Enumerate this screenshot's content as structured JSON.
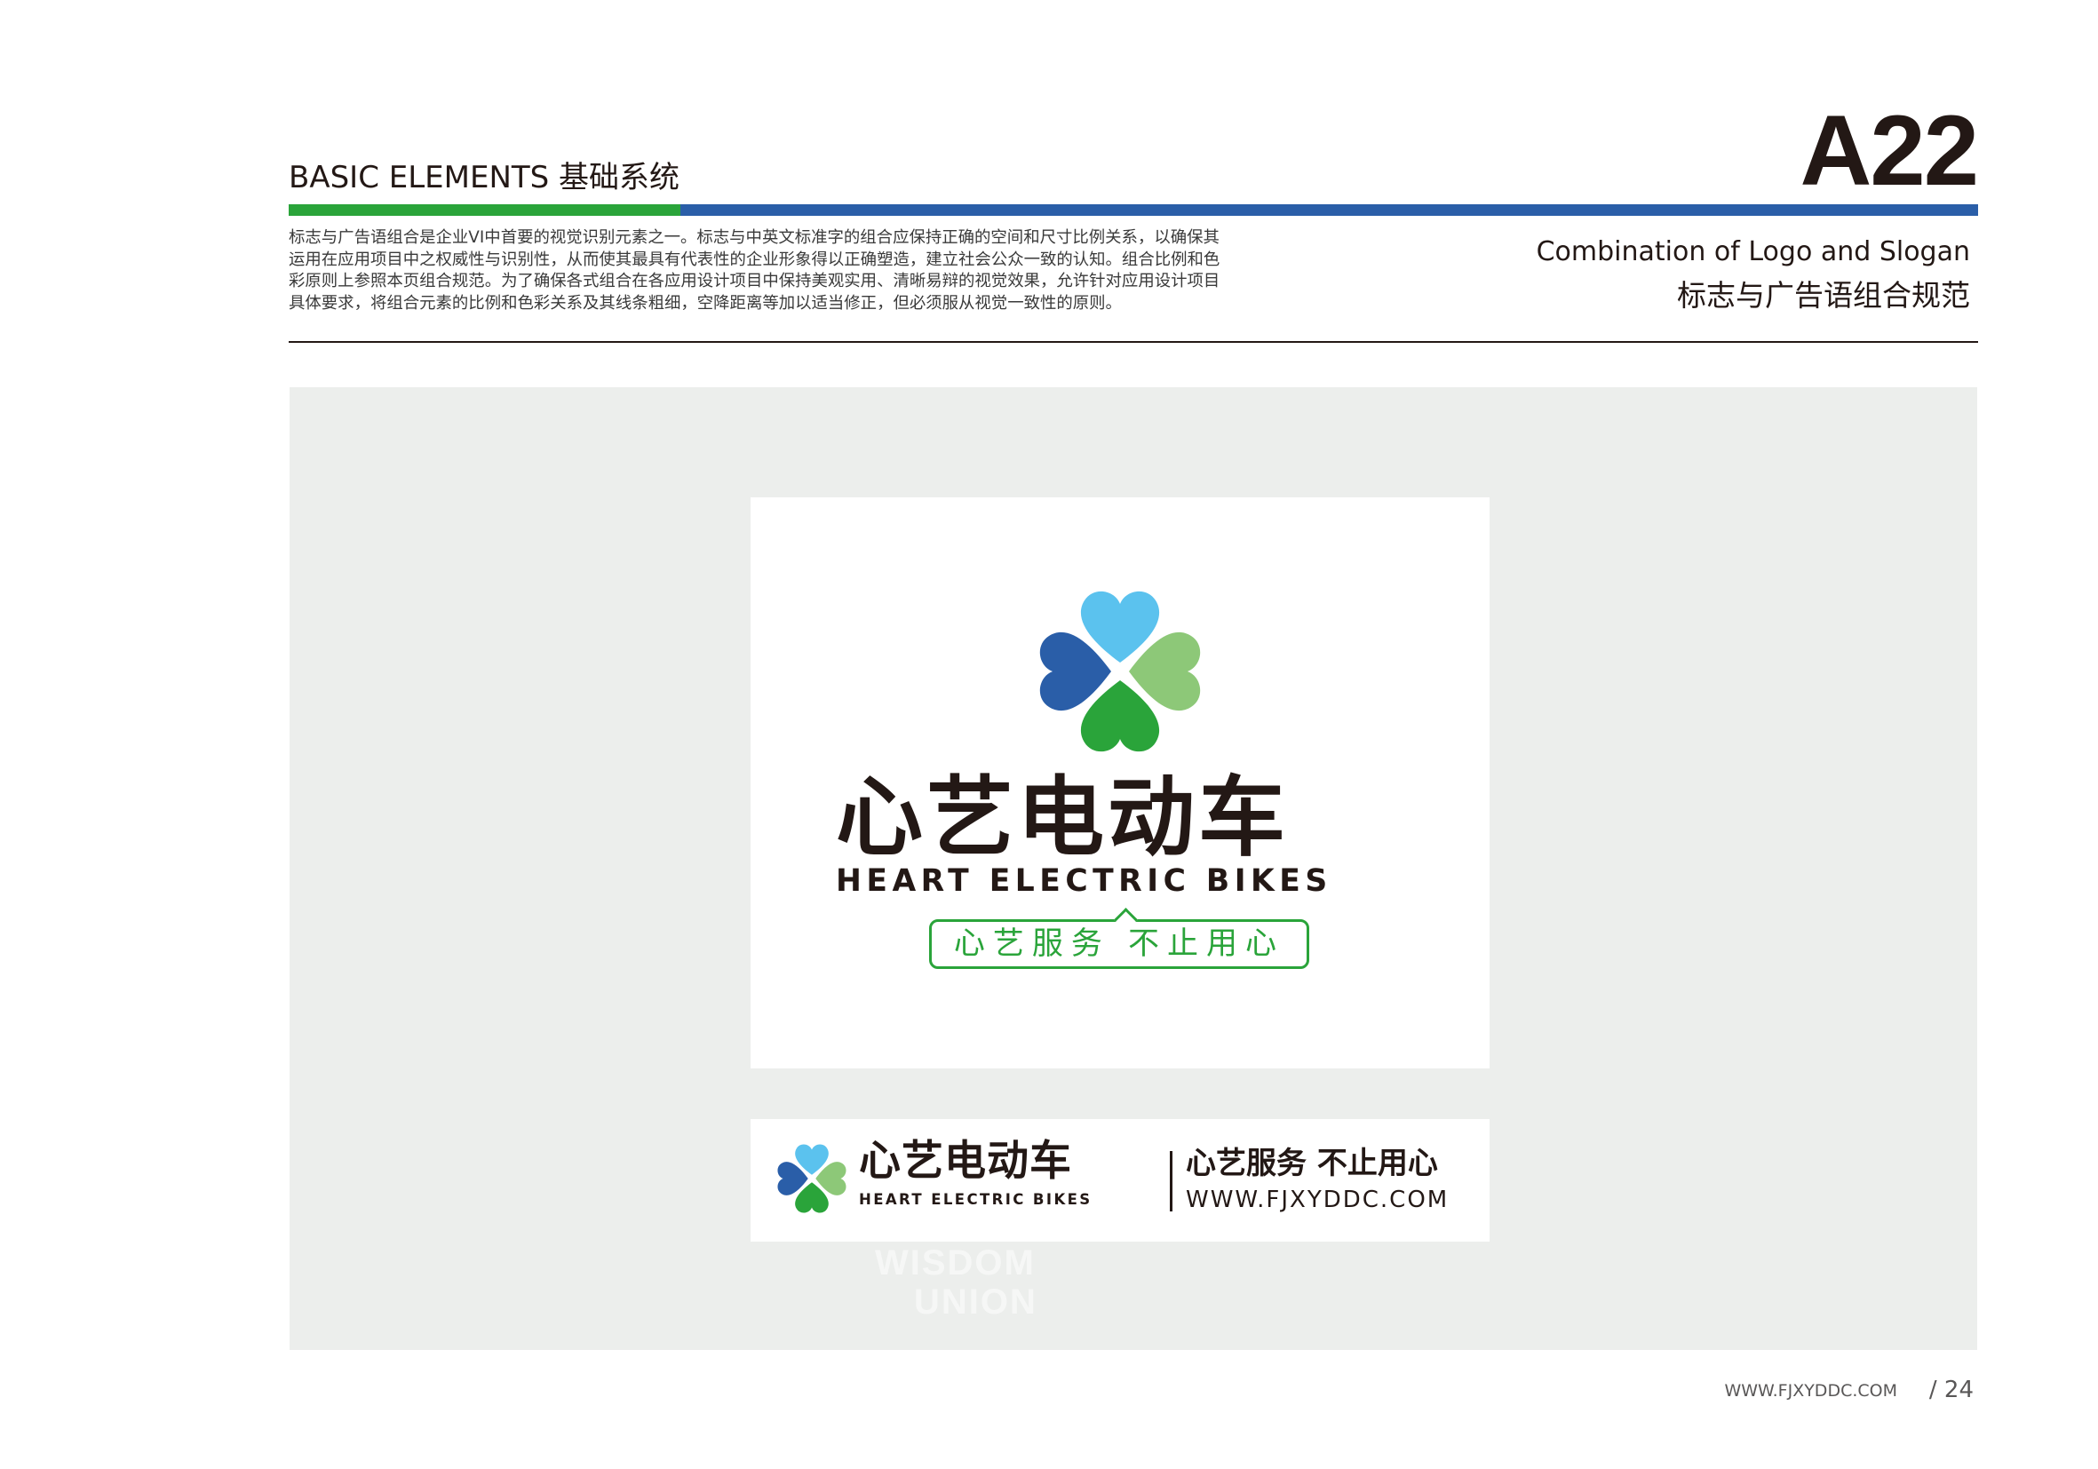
{
  "header": {
    "section_title": "BASIC ELEMENTS 基础系统",
    "page_code": "A22",
    "heading_en": "Combination of Logo and Slogan",
    "heading_zh": "标志与广告语组合规范",
    "intro_lines": [
      "标志与广告语组合是企业VI中首要的视觉识别元素之一。标志与中英文标准字的组合应保持正确的空间和尺寸比例关系，以确保其",
      "运用在应用项目中之权威性与识别性，从而使其最具有代表性的企业形象得以正确塑造，建立社会公众一致的认知。组合比例和色",
      "彩原则上参照本页组合规范。为了确保各式组合在各应用设计项目中保持美观实用、清晰易辩的视觉效果，允许针对应用设计项目",
      "具体要求，将组合元素的比例和色彩关系及其线条粗细，空降距离等加以适当修正，但必须服从视觉一致性的原则。"
    ]
  },
  "logo": {
    "name_zh": "心艺电动车",
    "name_en": "HEART ELECTRIC BIKES",
    "slogan": "心艺服务 不止用心",
    "website": "WWW.FJXYDDC.COM"
  },
  "watermark": {
    "en": "WISDOM",
    "en2": "UNION"
  },
  "footer": {
    "url": "WWW.FJXYDDC.COM",
    "page": "/ 24"
  },
  "colors": {
    "green": "#2aa43a",
    "blue": "#2a5ea8",
    "light_blue": "#5bc2ee",
    "light_green": "#8dc878",
    "text": "#231815"
  }
}
